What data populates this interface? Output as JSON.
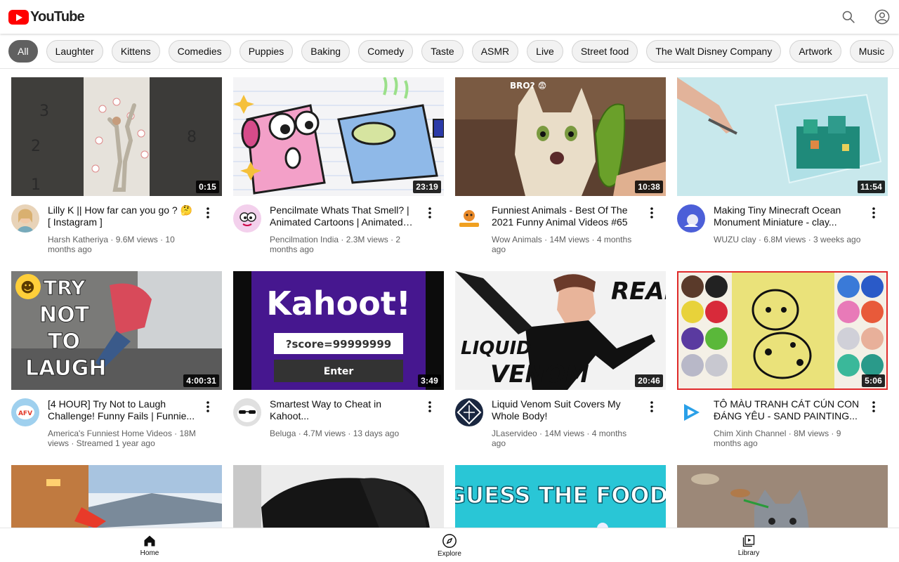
{
  "header": {
    "logo_text": "YouTube",
    "search_icon": "search-icon",
    "account_icon": "account-icon"
  },
  "chips": [
    "All",
    "Laughter",
    "Kittens",
    "Comedies",
    "Puppies",
    "Baking",
    "Comedy",
    "Taste",
    "ASMR",
    "Live",
    "Street food",
    "The Walt Disney Company",
    "Artwork",
    "Music"
  ],
  "videos": [
    {
      "title": "Lilly K || How far can you go ? 🤔 [ Instagram ]",
      "channel": "Harsh Katheriya",
      "stats": "9.6M views · 10 months ago",
      "duration": "0:15"
    },
    {
      "title": "Pencilmate Whats That Smell? | Animated Cartoons | Animated Short Films",
      "channel": "Pencilmation India",
      "stats": "2.3M views · 2 months ago",
      "duration": "23:19"
    },
    {
      "title": "Funniest Animals - Best Of The 2021 Funny Animal Videos #65",
      "channel": "Wow Animals",
      "stats": "14M views · 4 months ago",
      "duration": "10:38",
      "thumb_text": "BRO? 😨"
    },
    {
      "title": "Making Tiny Minecraft Ocean Monument Miniature - clay...",
      "channel": "WUZU clay",
      "stats": "6.8M views · 3 weeks ago",
      "duration": "11:54"
    },
    {
      "title": "[4 HOUR] Try Not to Laugh Challenge! Funny Fails | Funnie...",
      "channel": "America's Funniest Home Videos",
      "stats": "18M views · Streamed 1 year ago",
      "duration": "4:00:31",
      "thumb_text": [
        "TRY",
        "NOT",
        "TO",
        "LAUGH"
      ],
      "avatar_text": "AFV"
    },
    {
      "title": "Smartest Way to Cheat in Kahoot...",
      "channel": "Beluga",
      "stats": "4.7M views · 13 days ago",
      "duration": "3:49",
      "thumb_text": {
        "brand": "Kahoot!",
        "field": "?score=99999999",
        "button": "Enter"
      }
    },
    {
      "title": "Liquid Venom Suit Covers My Whole Body!",
      "channel": "JLaservideo",
      "stats": "14M views · 4 months ago",
      "duration": "20:46",
      "thumb_text": [
        "REAL",
        "LIQUID",
        "VENOM"
      ]
    },
    {
      "title": "TÔ MÀU TRANH CÁT CÚN CON ĐÁNG YÊU - SAND PAINTING...",
      "channel": "Chim Xinh Channel",
      "stats": "8M views · 9 months ago",
      "duration": "5:06"
    },
    {
      "title": "",
      "channel": "",
      "stats": "",
      "duration": ""
    },
    {
      "title": "",
      "channel": "",
      "stats": "",
      "duration": ""
    },
    {
      "title": "",
      "channel": "",
      "stats": "",
      "duration": "",
      "thumb_text": "GUESS THE FOOD"
    },
    {
      "title": "",
      "channel": "",
      "stats": "",
      "duration": ""
    }
  ],
  "bottom_nav": [
    {
      "label": "Home",
      "icon": "home-icon"
    },
    {
      "label": "Explore",
      "icon": "compass-icon"
    },
    {
      "label": "Library",
      "icon": "library-icon"
    }
  ],
  "colors": {
    "brand": "#ff0000",
    "chip_active": "#606060",
    "chip_bg": "#f2f2f2",
    "text_secondary": "#606060"
  }
}
